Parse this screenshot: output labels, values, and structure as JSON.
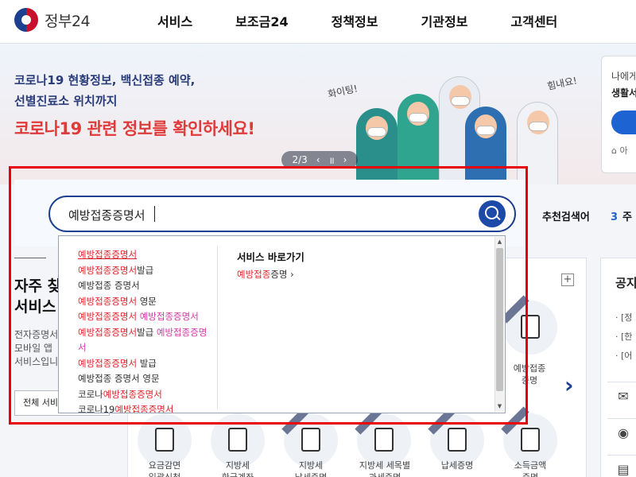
{
  "header": {
    "logo_text": "정부24",
    "nav": [
      "서비스",
      "보조금24",
      "정책정보",
      "기관정보",
      "고객센터"
    ]
  },
  "banner": {
    "line1": "코로나19 현황정보, 백신접종 예약,",
    "line2": "선별진료소 위치까지",
    "line3": "코로나19 관련 정보를 확인하세요!",
    "fighting_text": "화이팅!",
    "cheer_text": "힘내요!",
    "pager": {
      "current": "2/3",
      "prev": "‹",
      "pause": "॥",
      "next": "›"
    },
    "login_card": {
      "line1": "나에게",
      "line2": "생활서",
      "lock_text": "아"
    }
  },
  "search": {
    "query": "예방접종증명서",
    "button_icon": "search-icon",
    "recommended_label": "추천검색어",
    "recommended_extra_num": "3",
    "recommended_extra_text": "주"
  },
  "autocomplete": {
    "suggestions": [
      {
        "parts": [
          {
            "t": "예방접종증명서",
            "s": "hl"
          }
        ],
        "first": true
      },
      {
        "parts": [
          {
            "t": "예방접종증명서",
            "s": "hl"
          },
          {
            "t": "발급",
            "s": ""
          }
        ]
      },
      {
        "parts": [
          {
            "t": "예방접종 증명서",
            "s": ""
          }
        ]
      },
      {
        "parts": [
          {
            "t": "예방접종증명서",
            "s": "hl"
          },
          {
            "t": " 영문",
            "s": ""
          }
        ]
      },
      {
        "parts": [
          {
            "t": "예방접종증명서",
            "s": "hl"
          },
          {
            "t": " 예방접종증명서",
            "s": "pink"
          }
        ]
      },
      {
        "parts": [
          {
            "t": "예방접종증명서",
            "s": "hl"
          },
          {
            "t": "발급 ",
            "s": ""
          },
          {
            "t": "예방접종증명서",
            "s": "pink"
          }
        ],
        "wrap": true
      },
      {
        "parts": [
          {
            "t": "예방접종증명서",
            "s": "hl"
          },
          {
            "t": " 발급",
            "s": ""
          }
        ]
      },
      {
        "parts": [
          {
            "t": "예방접종 증명서 영문",
            "s": ""
          }
        ]
      },
      {
        "parts": [
          {
            "t": "코로나",
            "s": ""
          },
          {
            "t": "예방접종증명서",
            "s": "hl"
          }
        ]
      },
      {
        "parts": [
          {
            "t": "코로나19",
            "s": ""
          },
          {
            "t": "예방접종증명서",
            "s": "hl"
          }
        ]
      }
    ],
    "shortcut_title": "서비스 바로가기",
    "shortcut_hl": "예방접종",
    "shortcut_rest": "증명",
    "shortcut_arrow": "›"
  },
  "lower": {
    "section_title_1": "자주 찾",
    "section_title_2": "서비스",
    "section_desc": [
      "전자증명서",
      "모바일 앱",
      "서비스입니"
    ],
    "section_button": "전체 서비",
    "plus": "+",
    "next_arrow": "›",
    "services": [
      {
        "label": "예방접종\n증명"
      },
      {
        "label": "요금감면\n일괄신청"
      },
      {
        "label": "지방세\n환급계좌"
      },
      {
        "label": "지방세\n납세증명"
      },
      {
        "label": "지방세 세목별\n과세증명"
      },
      {
        "label": "납세증명"
      },
      {
        "label": "소득금액\n증명"
      }
    ],
    "right_panel": {
      "title": "공지",
      "items": [
        "· [정",
        "· [한",
        "· [어"
      ]
    }
  },
  "floating": [
    "chat-icon",
    "location-icon",
    "document-icon"
  ],
  "colors": {
    "brand_navy": "#1d3f8f",
    "highlight_red": "#e0242c",
    "pink": "#d63aa8",
    "frame_red": "#e8000b"
  }
}
